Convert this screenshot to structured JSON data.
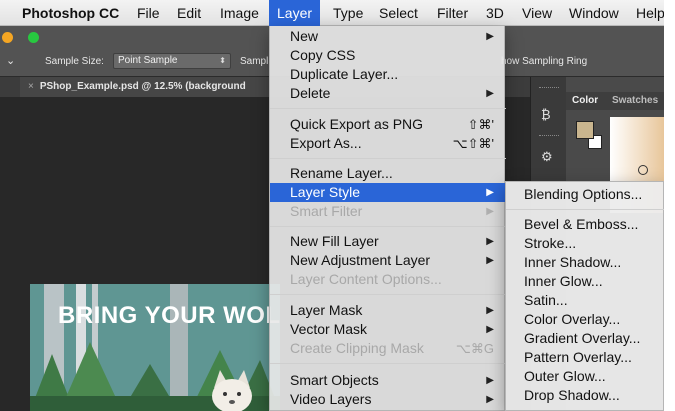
{
  "menubar": {
    "app_name": "Photoshop CC",
    "items": [
      "File",
      "Edit",
      "Image",
      "Layer",
      "Type",
      "Select",
      "Filter",
      "3D",
      "View",
      "Window",
      "Help"
    ],
    "active": "Layer"
  },
  "options_bar": {
    "sample_size_label": "Sample Size:",
    "sample_size_value": "Point Sample",
    "sample_label_truncated": "Sampl",
    "show_sampling_ring": "how Sampling Ring",
    "traffic_colors": [
      "#f5a623",
      "#28c840"
    ]
  },
  "document_tab": {
    "close_glyph": "×",
    "title": "PShop_Example.psd @ 12.5% (background"
  },
  "artwork": {
    "headline": "BRING YOUR WOL"
  },
  "panels": {
    "tabs": [
      "Color",
      "Swatches"
    ],
    "foreground_color": "#c9b58e",
    "background_color": "#ffffff"
  },
  "layer_menu": {
    "groups": [
      [
        {
          "label": "New",
          "submenu": true
        },
        {
          "label": "Copy CSS"
        },
        {
          "label": "Duplicate Layer..."
        },
        {
          "label": "Delete",
          "submenu": true
        }
      ],
      [
        {
          "label": "Quick Export as PNG",
          "shortcut": "⇧⌘'"
        },
        {
          "label": "Export As...",
          "shortcut": "⌥⇧⌘'"
        }
      ],
      [
        {
          "label": "Rename Layer..."
        },
        {
          "label": "Layer Style",
          "submenu": true,
          "highlighted": true
        },
        {
          "label": "Smart Filter",
          "submenu": true,
          "disabled": true
        }
      ],
      [
        {
          "label": "New Fill Layer",
          "submenu": true
        },
        {
          "label": "New Adjustment Layer",
          "submenu": true
        },
        {
          "label": "Layer Content Options...",
          "disabled": true
        }
      ],
      [
        {
          "label": "Layer Mask",
          "submenu": true
        },
        {
          "label": "Vector Mask",
          "submenu": true
        },
        {
          "label": "Create Clipping Mask",
          "shortcut": "⌥⌘G",
          "disabled": true
        }
      ],
      [
        {
          "label": "Smart Objects",
          "submenu": true
        },
        {
          "label": "Video Layers",
          "submenu": true
        }
      ]
    ]
  },
  "layer_style_submenu": {
    "items": [
      "Blending Options...",
      "Bevel & Emboss...",
      "Stroke...",
      "Inner Shadow...",
      "Inner Glow...",
      "Satin...",
      "Color Overlay...",
      "Gradient Overlay...",
      "Pattern Overlay...",
      "Outer Glow...",
      "Drop Shadow..."
    ]
  },
  "colors": {
    "highlight": "#2a65d7"
  }
}
